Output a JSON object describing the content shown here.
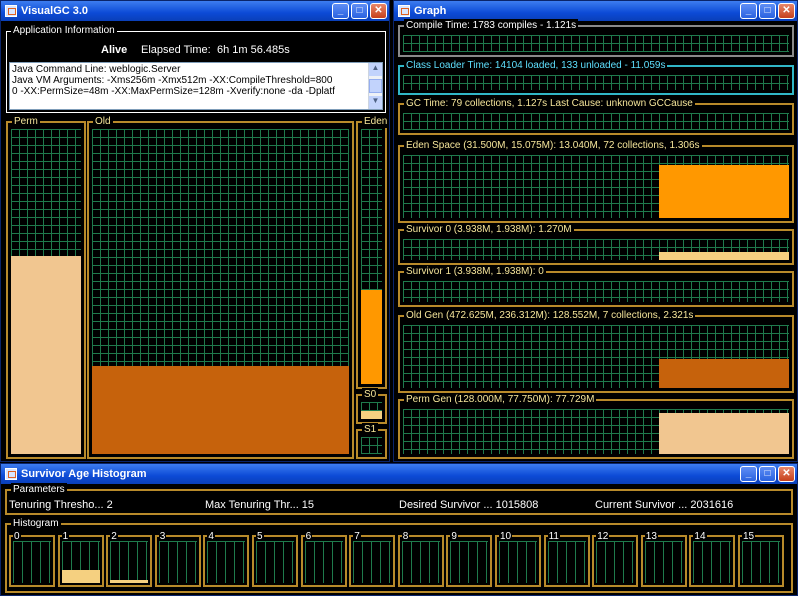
{
  "visualgc": {
    "title": "VisualGC 3.0",
    "app_info": {
      "legend": "Application Information",
      "alive": "Alive",
      "elapsed_label": "Elapsed Time:",
      "elapsed_value": "6h 1m 56.485s",
      "lines": [
        "Java Command Line: weblogic.Server",
        "",
        "Java VM Arguments: -Xms256m -Xmx512m -XX:CompileThreshold=800",
        "0 -XX:PermSize=48m -XX:MaxPermSize=128m -Xverify:none -da -Dplatf"
      ]
    },
    "perm": {
      "label": "Perm",
      "level": 0.61
    },
    "old": {
      "label": "Old",
      "level": 0.27
    },
    "eden": {
      "label": "Eden",
      "level": 0.37
    },
    "s0": {
      "label": "S0",
      "level": 0.5
    },
    "s1": {
      "label": "S1",
      "level": 0
    }
  },
  "graph": {
    "title": "Graph",
    "compile": "Compile Time: 1783 compiles - 1.121s",
    "classloader": "Class Loader Time: 14104 loaded, 133 unloaded - 11.059s",
    "gc": "GC Time: 79 collections, 1.127s  Last Cause: unknown GCCause",
    "eden": "Eden Space (31.500M, 15.075M): 13.040M, 72 collections, 1.306s",
    "s0": "Survivor 0 (3.938M, 1.938M): 1.270M",
    "s1": "Survivor 1 (3.938M, 1.938M): 0",
    "old": "Old Gen (472.625M, 236.312M): 128.552M, 7 collections, 2.321s",
    "perm": "Perm Gen (128.000M, 77.750M): 77.729M"
  },
  "histogram": {
    "title": "Survivor Age Histogram",
    "params_legend": "Parameters",
    "params": [
      "Tenuring Thresho... 2",
      "Max Tenuring Thr... 15",
      "Desired Survivor ... 1015808",
      "Current Survivor ... 2031616"
    ],
    "hist_legend": "Histogram",
    "bins": [
      "0",
      "1",
      "2",
      "3",
      "4",
      "5",
      "6",
      "7",
      "8",
      "9",
      "10",
      "11",
      "12",
      "13",
      "14",
      "15"
    ],
    "bin_levels": [
      0,
      0.3,
      0.08,
      0,
      0,
      0,
      0,
      0,
      0,
      0,
      0,
      0,
      0,
      0,
      0,
      0
    ]
  },
  "colors": {
    "perm": "#f1c690",
    "old": "#c6620c",
    "eden": "#ff9800",
    "s0": "#f5d080",
    "grid": "#1f7a4c",
    "border": "#b88a2a"
  }
}
